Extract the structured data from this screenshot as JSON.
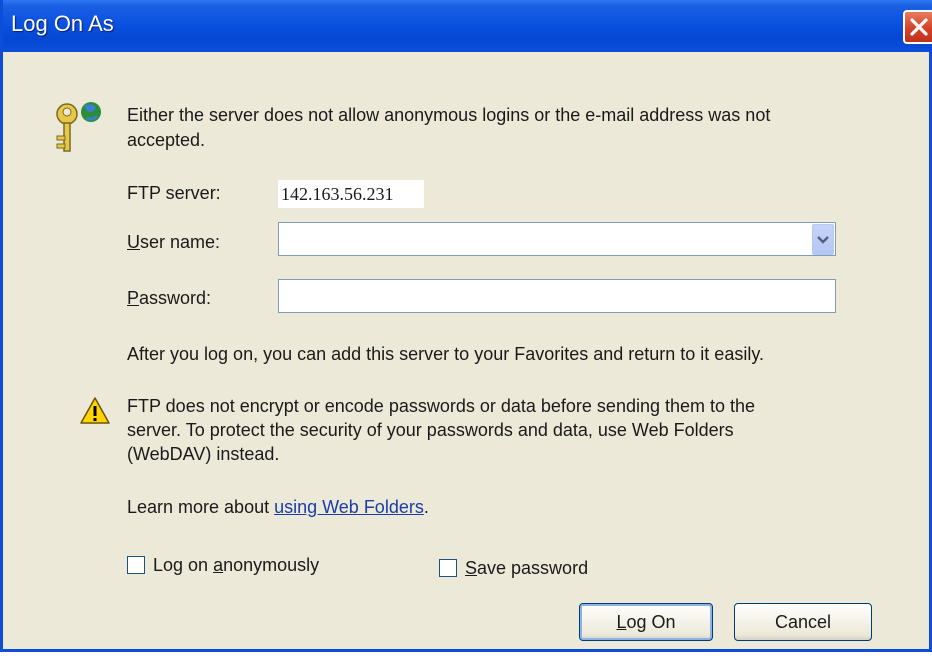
{
  "window": {
    "title": "Log On As"
  },
  "message": {
    "line1": "Either the server does not allow anonymous logins or the e-mail address was not",
    "line2": "accepted."
  },
  "ftp_server": {
    "label": "FTP server:",
    "value": "142.163.56.231"
  },
  "user_name": {
    "label_access_key": "U",
    "label_rest": "ser name:",
    "value": ""
  },
  "password": {
    "label_access_key": "P",
    "label_rest": "assword:",
    "value": ""
  },
  "favorites_note": "After you log on, you can add this server to your Favorites and return to it easily.",
  "warning": {
    "line1": "FTP does not encrypt or encode passwords or data before sending them to the",
    "line2": "server.  To protect the security of your passwords and data, use Web Folders",
    "line3": "(WebDAV) instead."
  },
  "learn_more": {
    "prefix": "Learn more about ",
    "link": "using Web Folders",
    "suffix": "."
  },
  "anonymous_checkbox": {
    "before": "Log on ",
    "access_key": "a",
    "after": "nonymously",
    "checked": false
  },
  "save_password_checkbox": {
    "access_key": "S",
    "rest": "ave password",
    "checked": false
  },
  "buttons": {
    "log_on": {
      "access_key": "L",
      "rest": "og On"
    },
    "cancel": "Cancel"
  },
  "icons": {
    "header": "keys-globe-icon",
    "warning": "warning-triangle-icon",
    "close": "close-icon",
    "dropdown": "chevron-down-icon"
  },
  "colors": {
    "titlebar": "#0a52e0",
    "dialog_background": "#ece9d8",
    "close_button": "#d3422a",
    "link": "#1a3da8"
  }
}
